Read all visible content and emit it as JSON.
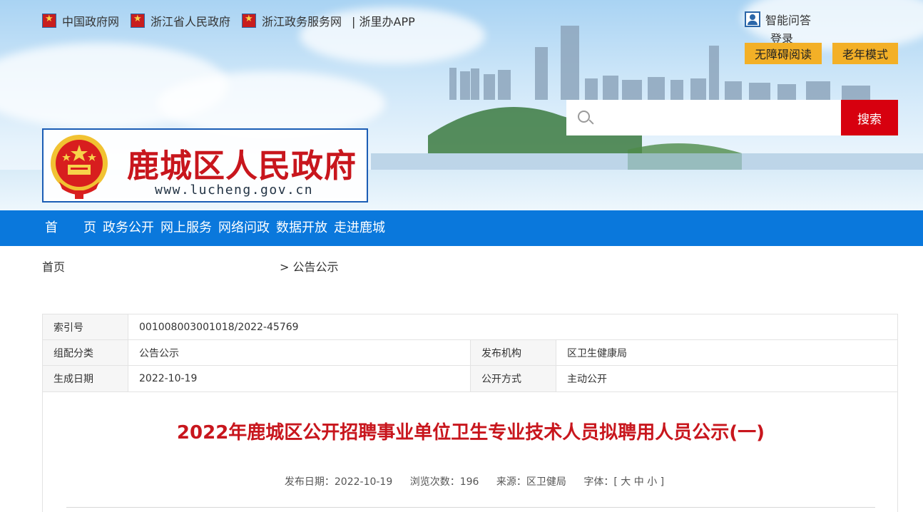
{
  "toplinks": [
    {
      "label": "中国政府网",
      "icon": "emblem-icon"
    },
    {
      "label": "浙江省人民政府",
      "icon": "emblem-icon"
    },
    {
      "label": "浙江政务服务网",
      "icon": "emblem-icon"
    }
  ],
  "toplink_app": "| 浙里办APP",
  "assistant": {
    "label": "智能问答",
    "icon": "user-icon"
  },
  "login_label": "登录",
  "accessibility_label": "无障碍阅读",
  "elder_mode_label": "老年模式",
  "search": {
    "placeholder": "",
    "button": "搜索",
    "icon": "search-icon"
  },
  "logo": {
    "title": "鹿城区人民政府",
    "url": "www.lucheng.gov.cn"
  },
  "nav": [
    "首　　页",
    "政务公开",
    "网上服务",
    "网络问政",
    "数据开放",
    "走进鹿城"
  ],
  "breadcrumb": {
    "home": "首页",
    "current": "> 公告公示"
  },
  "info": {
    "index_label": "索引号",
    "index_value": "001008003001018/2022-45769",
    "category_label": "组配分类",
    "category_value": "公告公示",
    "publisher_label": "发布机构",
    "publisher_value": "区卫生健康局",
    "date_label": "生成日期",
    "date_value": "2022-10-19",
    "mode_label": "公开方式",
    "mode_value": "主动公开"
  },
  "article": {
    "title": "2022年鹿城区公开招聘事业单位卫生专业技术人员拟聘用人员公示(一)",
    "publish_date": "发布日期：2022-10-19",
    "views": "浏览次数：196",
    "source": "来源：区卫健局",
    "font_label": "字体：[",
    "font_large": "大",
    "font_medium": "中",
    "font_small": "小",
    "font_close": "]"
  },
  "colors": {
    "nav_blue": "#0a78dc",
    "search_red": "#d7000f",
    "title_red": "#c8161d",
    "button_yellow": "#f3b027"
  }
}
